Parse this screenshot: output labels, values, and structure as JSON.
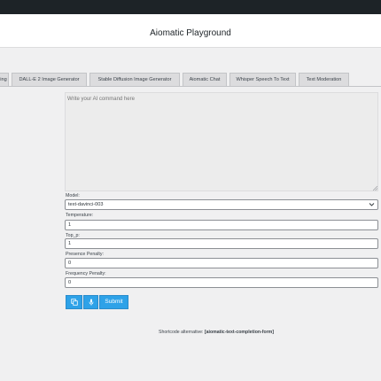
{
  "header": {
    "title": "Aiomatic Playground"
  },
  "tabs": [
    {
      "label": "ing"
    },
    {
      "label": "DALL-E 2 Image Generator"
    },
    {
      "label": "Stable Diffusion Image Generator"
    },
    {
      "label": "Aiomatic Chat"
    },
    {
      "label": "Whisper Speech To Text"
    },
    {
      "label": "Text Moderation"
    }
  ],
  "form": {
    "prompt_placeholder": "Write your AI command here",
    "model_label": "Model:",
    "model_value": "text-davinci-003",
    "temperature_label": "Temperature:",
    "temperature_value": "1",
    "top_p_label": "Top_p:",
    "top_p_value": "1",
    "presence_label": "Presence Penalty:",
    "presence_value": "0",
    "frequency_label": "Frequency Penalty:",
    "frequency_value": "0"
  },
  "buttons": {
    "copy_icon": "copy-icon",
    "mic_icon": "microphone-icon",
    "submit_label": "Submit"
  },
  "footer": {
    "shortcode_prefix": "Shortcode alternative:",
    "shortcode_value": "[aiomatic-text-completion-form]"
  },
  "colors": {
    "accent": "#2ea2e8",
    "topbar": "#1d2327"
  }
}
